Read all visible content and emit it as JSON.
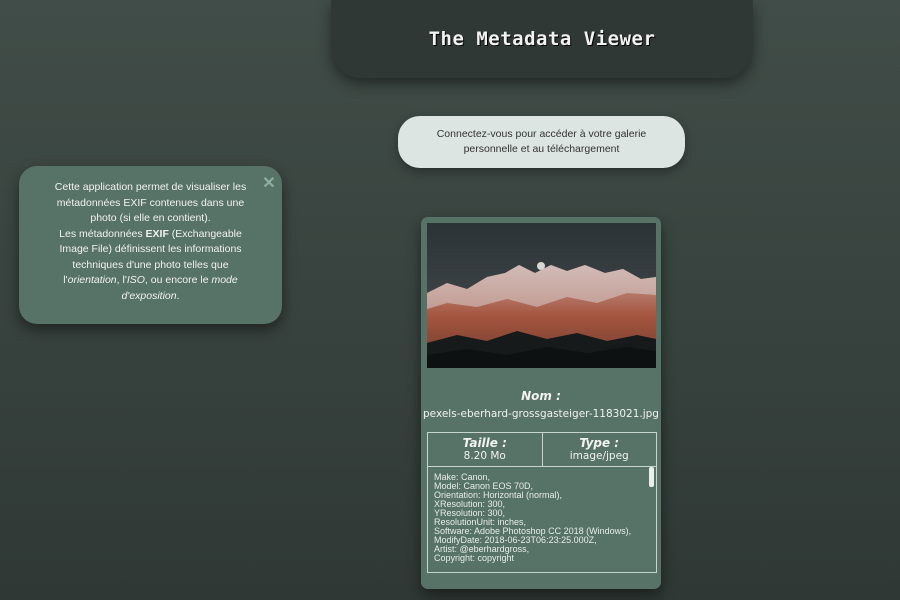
{
  "header": {
    "title": "The Metadata Viewer"
  },
  "login_prompt": {
    "line1": "Connectez-vous pour accéder à votre galerie",
    "line2": "personnelle et au téléchargement"
  },
  "info_panel": {
    "para1": "Cette application permet de visualiser les métadonnées EXIF contenues dans une photo (si elle en contient).",
    "para2_a": "Les métadonnées ",
    "para2_b": "EXIF",
    "para2_c": " (Exchangeable Image File) définissent les informations techniques d'une photo telles que l'",
    "para2_d": "orientation",
    "para2_e": ", l'",
    "para2_f": "ISO",
    "para2_g": ", ou encore le ",
    "para2_h": "mode d'exposition",
    "para2_i": ".",
    "close_icon": "close-icon"
  },
  "card": {
    "name_label": "Nom :",
    "file_name": "pexels-eberhard-grossgasteiger-1183021.jpg",
    "size_label": "Taille :",
    "size_value": "8.20 Mo",
    "type_label": "Type :",
    "type_value": "image/jpeg",
    "exif_lines": [
      "Make: Canon,",
      "Model: Canon EOS 70D,",
      "Orientation: Horizontal (normal),",
      "XResolution: 300,",
      "YResolution: 300,",
      "ResolutionUnit: inches,",
      "Software: Adobe Photoshop CC 2018 (Windows),",
      "ModifyDate: 2018-06-23T06:23:25.000Z,",
      "Artist: @eberhardgross,",
      "Copyright: copyright"
    ]
  },
  "colors": {
    "background": "#3a4541",
    "panel": "#577267",
    "title_bar": "#2f3835",
    "pill": "#dce5e2"
  }
}
